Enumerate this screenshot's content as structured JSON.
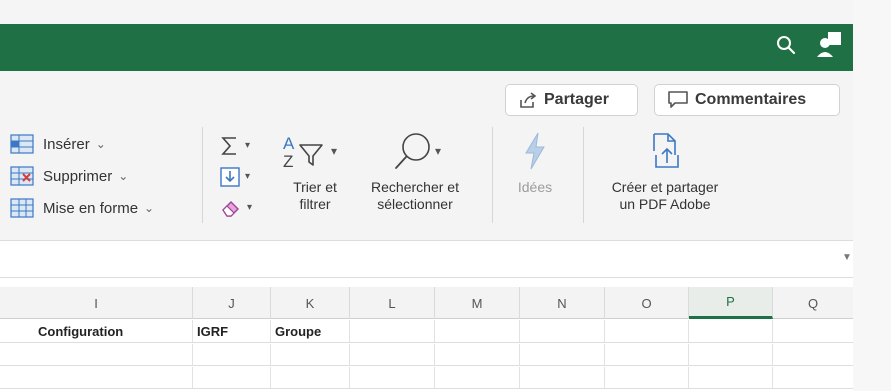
{
  "ribbon": {
    "share_label": "Partager",
    "comments_label": "Commentaires",
    "cells": {
      "insert_label": "Insérer",
      "delete_label": "Supprimer",
      "format_label": "Mise en forme"
    },
    "sort_filter_line1": "Trier et",
    "sort_filter_line2": "filtrer",
    "find_select_line1": "Rechercher et",
    "find_select_line2": "sélectionner",
    "ideas_label": "Idées",
    "pdf_line1": "Créer et partager",
    "pdf_line2": "un PDF Adobe"
  },
  "grid": {
    "columns": [
      "I",
      "J",
      "K",
      "L",
      "M",
      "N",
      "O",
      "P",
      "Q"
    ],
    "active_column": "P",
    "row1": {
      "I": "Configuration",
      "J": "IGRF",
      "K": "Groupe"
    }
  },
  "colors": {
    "accent": "#1f7145",
    "ribbon_bg": "#f4f4f4"
  },
  "icons": {
    "search": "search-icon",
    "account": "account-icon",
    "share": "share-icon",
    "comment": "comment-icon",
    "insert": "insert-cells-icon",
    "delete": "delete-cells-icon",
    "format": "format-cells-icon",
    "autosum": "autosum-icon",
    "fill": "fill-icon",
    "clear": "eraser-icon",
    "sortfilter": "sort-filter-icon",
    "find": "magnifier-icon",
    "ideas": "lightning-icon",
    "pdf": "pdf-share-icon"
  }
}
